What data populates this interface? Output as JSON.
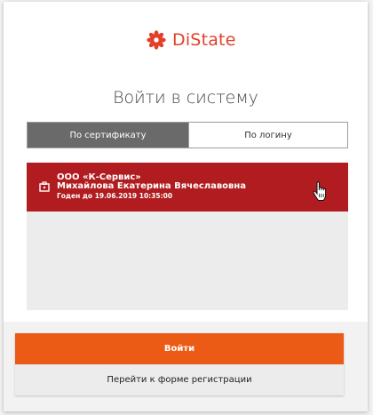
{
  "brand": {
    "name": "DiState",
    "logo_icon": "flower-logo-icon",
    "color": "#e2402a"
  },
  "title": "Войти в систему",
  "tabs": [
    {
      "label": "По сертификату",
      "active": true
    },
    {
      "label": "По логину",
      "active": false
    }
  ],
  "certificate": {
    "icon": "certificate-case-icon",
    "organization": "ООО «К-Сервис»",
    "owner": "Михайлова Екатерина Вячеславовна",
    "valid_until": "Годен до 19.06.2019 10:35:00",
    "selected_color": "#b01c1f"
  },
  "actions": {
    "login_label": "Войти",
    "login_color": "#ec5b16",
    "register_label": "Перейти к форме регистрации"
  },
  "cursor_icon": "hand-pointer-icon"
}
